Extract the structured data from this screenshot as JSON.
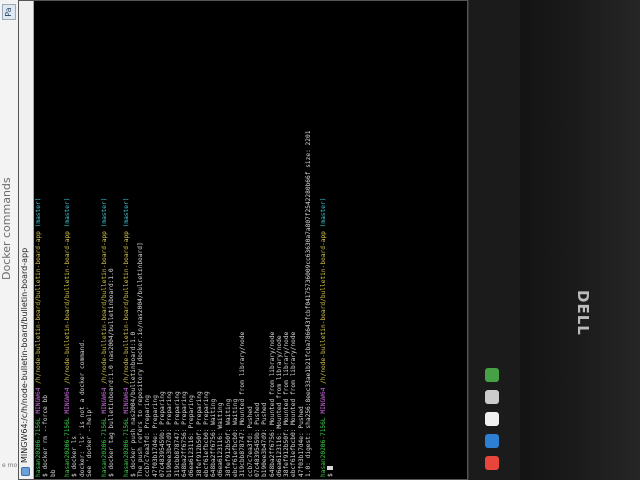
{
  "document_heading": "Docker commands",
  "document_button": "Pa",
  "side_note": "e mo",
  "window": {
    "title": "MINGW64:/c/h/node-bulletin-board/bulletin-board-app"
  },
  "terminal_lines": [
    {
      "parts": [
        {
          "t": "hasan20206-7156L ",
          "c": "green"
        },
        {
          "t": "MINGW64 ",
          "c": "purple"
        },
        {
          "t": "/h/node-bulletin-board/bulletin-board-app ",
          "c": "yellow"
        },
        {
          "t": "(master)",
          "c": "cyan"
        }
      ]
    },
    {
      "parts": [
        {
          "t": "$ docker rm --force bb",
          "c": ""
        }
      ]
    },
    {
      "parts": [
        {
          "t": "bb",
          "c": ""
        }
      ]
    },
    {
      "parts": [
        {
          "t": "",
          "c": ""
        }
      ]
    },
    {
      "parts": [
        {
          "t": "hasan20206-7156L ",
          "c": "green"
        },
        {
          "t": "MINGW64 ",
          "c": "purple"
        },
        {
          "t": "/h/node-bulletin-board/bulletin-board-app ",
          "c": "yellow"
        },
        {
          "t": "(master)",
          "c": "cyan"
        }
      ]
    },
    {
      "parts": [
        {
          "t": "$ docker ls",
          "c": ""
        }
      ]
    },
    {
      "parts": [
        {
          "t": "docker: 'ls' is not a docker command.",
          "c": ""
        }
      ]
    },
    {
      "parts": [
        {
          "t": "See 'docker --help'",
          "c": ""
        }
      ]
    },
    {
      "parts": [
        {
          "t": "",
          "c": ""
        }
      ]
    },
    {
      "parts": [
        {
          "t": "hasan20206-7156L ",
          "c": "green"
        },
        {
          "t": "MINGW64 ",
          "c": "purple"
        },
        {
          "t": "/h/node-bulletin-board/bulletin-board-app ",
          "c": "yellow"
        },
        {
          "t": "(master)",
          "c": "cyan"
        }
      ]
    },
    {
      "parts": [
        {
          "t": "$ docker tag bulletinboard:1.0 nas2004/bulletinboard:1.0",
          "c": ""
        }
      ]
    },
    {
      "parts": [
        {
          "t": "",
          "c": ""
        }
      ]
    },
    {
      "parts": [
        {
          "t": "hasan20206-7156L ",
          "c": "green"
        },
        {
          "t": "MINGW64 ",
          "c": "purple"
        },
        {
          "t": "/h/node-bulletin-board/bulletin-board-app ",
          "c": "yellow"
        },
        {
          "t": "(master)",
          "c": "cyan"
        }
      ]
    },
    {
      "parts": [
        {
          "t": "$ docker push nas2004/bulletinboard:1.0",
          "c": ""
        }
      ]
    },
    {
      "parts": [
        {
          "t": "The push refers to repository [docker.io/nas2004/bulletinboard]",
          "c": ""
        }
      ]
    },
    {
      "parts": [
        {
          "t": "ccb7c7ea3fd: Preparing",
          "c": ""
        }
      ]
    },
    {
      "parts": [
        {
          "t": "47f03b17d4e: Preparing",
          "c": ""
        }
      ]
    },
    {
      "parts": [
        {
          "t": "07c48395459b: Preparing",
          "c": ""
        }
      ]
    },
    {
      "parts": [
        {
          "t": "b190ee3b47d9: Preparing",
          "c": ""
        }
      ]
    },
    {
      "parts": [
        {
          "t": "319cbb878747: Preparing",
          "c": ""
        }
      ]
    },
    {
      "parts": [
        {
          "t": "648ba2ff6756: Preparing",
          "c": ""
        }
      ]
    },
    {
      "parts": [
        {
          "t": "d6ea6123116: Preparing",
          "c": ""
        }
      ]
    },
    {
      "parts": [
        {
          "t": "38fef912b50f: Preparing",
          "c": ""
        }
      ]
    },
    {
      "parts": [
        {
          "t": "ebcf61efbcb0: Preparing",
          "c": ""
        }
      ]
    },
    {
      "parts": [
        {
          "t": "648ba2ff6756: Waiting",
          "c": ""
        }
      ]
    },
    {
      "parts": [
        {
          "t": "d6ea6123116: Waiting",
          "c": ""
        }
      ]
    },
    {
      "parts": [
        {
          "t": "38fef912b50f: Waiting",
          "c": ""
        }
      ]
    },
    {
      "parts": [
        {
          "t": "ebcf61efbcb0: Waiting",
          "c": ""
        }
      ]
    },
    {
      "parts": [
        {
          "t": "319cbb878747: Mounted from library/node",
          "c": ""
        }
      ]
    },
    {
      "parts": [
        {
          "t": "ccb7c7ea3fd: Pushed",
          "c": ""
        }
      ]
    },
    {
      "parts": [
        {
          "t": "07c48395459b: Pushed",
          "c": ""
        }
      ]
    },
    {
      "parts": [
        {
          "t": "b190ee3b47d9: Pushed",
          "c": ""
        }
      ]
    },
    {
      "parts": [
        {
          "t": "648ba2ff6756: Mounted from library/node",
          "c": ""
        }
      ]
    },
    {
      "parts": [
        {
          "t": "d6ea6123116: Mounted from library/node",
          "c": ""
        }
      ]
    },
    {
      "parts": [
        {
          "t": "38fef912b50f: Mounted from library/node",
          "c": ""
        }
      ]
    },
    {
      "parts": [
        {
          "t": "ebcf61efbcb0: Mounted from library/node",
          "c": ""
        }
      ]
    },
    {
      "parts": [
        {
          "t": "47f03b17d4e: Pushed",
          "c": ""
        }
      ]
    },
    {
      "parts": [
        {
          "t": "1.0: digest: sha256:8eec33ae1b21fcba786643fcbf04175736009cc63630a7a807f2542280b66f size: 2201",
          "c": ""
        }
      ]
    },
    {
      "parts": [
        {
          "t": "",
          "c": ""
        }
      ]
    },
    {
      "parts": [
        {
          "t": "hasan20206-7156L ",
          "c": "green"
        },
        {
          "t": "MINGW64 ",
          "c": "purple"
        },
        {
          "t": "/h/node-bulletin-board/bulletin-board-app ",
          "c": "yellow"
        },
        {
          "t": "(master)",
          "c": "cyan"
        }
      ]
    },
    {
      "parts": [
        {
          "t": "$ ",
          "c": ""
        }
      ]
    }
  ],
  "colors": {
    "prompt_user": "#3fcf4a",
    "prompt_host": "#c66ad8",
    "prompt_path": "#d8c64a",
    "prompt_branch": "#3ec8d8",
    "terminal_bg": "#000000",
    "terminal_fg": "#d8d8d8"
  },
  "taskbar": {
    "icons": [
      {
        "name": "chrome-icon",
        "color": "#e8463a"
      },
      {
        "name": "edge-icon",
        "color": "#2d7fd3"
      },
      {
        "name": "store-icon",
        "color": "#f0f0f0"
      },
      {
        "name": "settings-icon",
        "color": "#cccccc"
      },
      {
        "name": "app-icon",
        "color": "#46a046"
      }
    ]
  },
  "monitor_brand": "DELL"
}
